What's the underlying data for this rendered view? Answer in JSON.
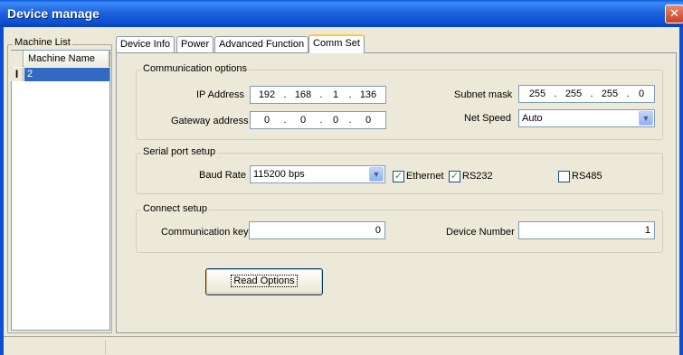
{
  "window": {
    "title": "Device manage",
    "close_glyph": "✕"
  },
  "machine_list": {
    "caption": "Machine List",
    "column_header": "Machine Name",
    "cursor_glyph": "I",
    "rows": [
      "2"
    ]
  },
  "tabs": [
    "Device Info",
    "Power",
    "Advanced Function",
    "Comm Set"
  ],
  "active_tab": "Comm Set",
  "communication_options": {
    "caption": "Communication options",
    "ip_label": "IP Address",
    "ip": [
      "192",
      "168",
      "1",
      "136"
    ],
    "subnet_label": "Subnet mask",
    "subnet": [
      "255",
      "255",
      "255",
      "0"
    ],
    "gateway_label": "Gateway address",
    "gateway": [
      "0",
      "0",
      "0",
      "0"
    ],
    "net_speed_label": "Net Speed",
    "net_speed_value": "Auto"
  },
  "serial_port": {
    "caption": "Serial port setup",
    "baud_label": "Baud Rate",
    "baud_value": "115200 bps",
    "ethernet_label": "Ethernet",
    "ethernet_checked": true,
    "rs232_label": "RS232",
    "rs232_checked": true,
    "rs485_label": "RS485",
    "rs485_checked": false
  },
  "connect_setup": {
    "caption": "Connect setup",
    "comm_key_label": "Communication key",
    "comm_key_value": "0",
    "device_number_label": "Device Number",
    "device_number_value": "1"
  },
  "read_options_label": "Read Options",
  "colors": {
    "title_bar": "#0b4fd2",
    "selection": "#316ac5",
    "dialog_bg": "#ece9d8",
    "check": "#21a121"
  }
}
